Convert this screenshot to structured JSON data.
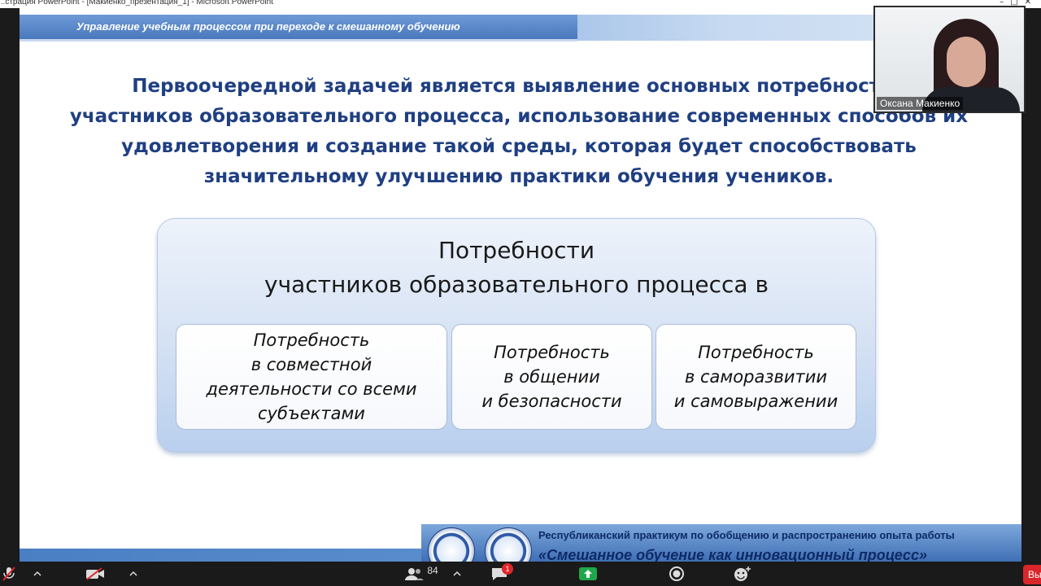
{
  "window": {
    "title": "...страция PowerPoint - [Макиенко_презентация_1] - Microsoft PowerPoint"
  },
  "slide": {
    "header_title": "Управление учебным процессом при переходе к смешанному обучению",
    "main_text": "Первоочередной задачей является выявление основных потребностей\nучастников образовательного процесса, использование современных способов их\nудовлетворения и создание такой среды, которая будет способствовать\nзначительному улучшению практики обучения учеников.",
    "needs_title": "Потребности\nучастников образовательного процесса в",
    "needs": [
      "Потребность\nв совместной\nдеятельности  со всеми\nсубъектами",
      "Потребность\nв общении\nи безопасности",
      "Потребность\nв саморазвитии\nи самовыражении"
    ],
    "footer": {
      "line1": "Республиканский практикум по обобщению и распространению опыта работы",
      "line2": "«Смешанное обучение как инновационный процесс»"
    }
  },
  "webcam": {
    "participant_name": "Оксана Макиенко"
  },
  "toolbar": {
    "participants_count": "84",
    "chat_badge": "1",
    "leave_label": "Выйти",
    "icons": [
      "mic-muted-icon",
      "video-off-icon",
      "participants-icon",
      "chat-icon",
      "share-screen-icon",
      "record-icon",
      "reactions-icon"
    ],
    "share_color": "#1fa84b",
    "leave_color": "#d9262b"
  }
}
